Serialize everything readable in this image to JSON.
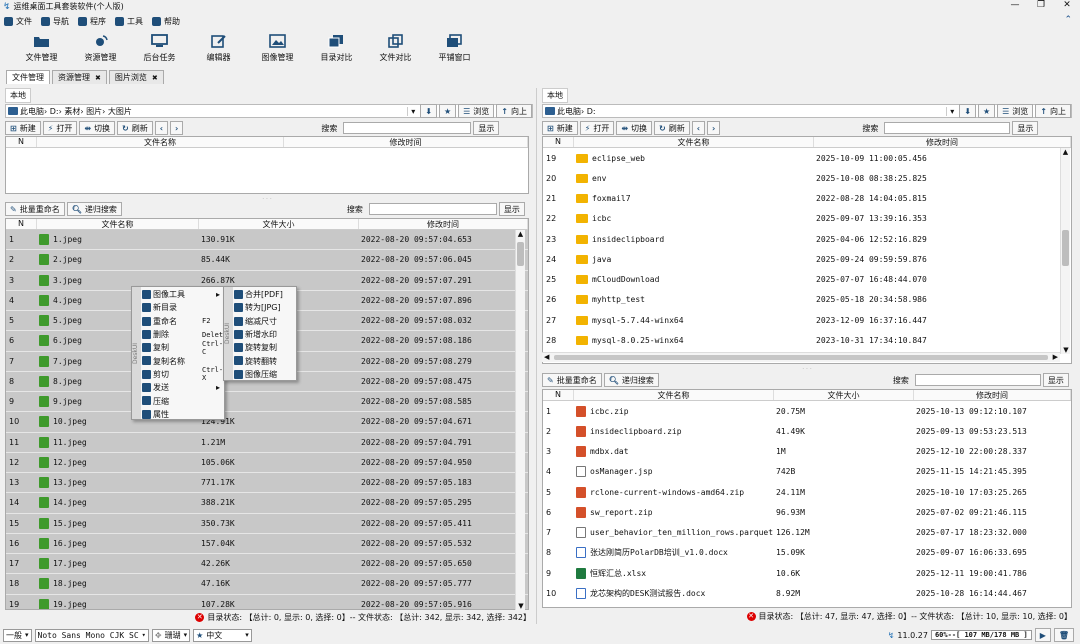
{
  "app": {
    "title": "运维桌面工具套装软件(个人版)"
  },
  "menu": [
    {
      "label": "文件",
      "icon": "file-icon"
    },
    {
      "label": "导航",
      "icon": "list-icon"
    },
    {
      "label": "程序",
      "icon": "keyboard-icon"
    },
    {
      "label": "工具",
      "icon": "toolbox-icon"
    },
    {
      "label": "帮助",
      "icon": "help-icon"
    }
  ],
  "toolbar": [
    {
      "label": "文件管理",
      "icon": "folder-open-icon"
    },
    {
      "label": "资源管理",
      "icon": "satellite-icon"
    },
    {
      "label": "后台任务",
      "icon": "monitor-icon"
    },
    {
      "label": "编辑器",
      "icon": "edit-icon"
    },
    {
      "label": "图像管理",
      "icon": "image-icon"
    },
    {
      "label": "目录对比",
      "icon": "copy-icon"
    },
    {
      "label": "文件对比",
      "icon": "file-compare-icon"
    },
    {
      "label": "平铺窗口",
      "icon": "windows-icon"
    }
  ],
  "tabs": [
    {
      "label": "文件管理",
      "closable": false
    },
    {
      "label": "资源管理",
      "closable": true,
      "close": "✖"
    },
    {
      "label": "图片浏览",
      "closable": true,
      "close": "✖"
    }
  ],
  "left": {
    "location": "本地",
    "path": "此电脑› D:› 素材› 图片› 大图片",
    "buttons": {
      "new": "新建",
      "open": "打开",
      "switch": "切换",
      "refresh": "刷新",
      "browse": "浏览",
      "up": "向上",
      "show": "显示",
      "search_label": "搜索",
      "batch_rename": "批量重命名",
      "recursive_search": "递归搜索"
    },
    "top_table_headers": [
      "N",
      "文件名称",
      "修改时间"
    ],
    "file_headers": [
      "N",
      "文件名称",
      "文件大小",
      "修改时间"
    ],
    "files": [
      {
        "n": "1",
        "name": "1.jpeg",
        "size": "130.91K",
        "time": "2022-08-20 09:57:04.653"
      },
      {
        "n": "2",
        "name": "2.jpeg",
        "size": "85.44K",
        "time": "2022-08-20 09:57:06.045"
      },
      {
        "n": "3",
        "name": "3.jpeg",
        "size": "266.87K",
        "time": "2022-08-20 09:57:07.291"
      },
      {
        "n": "4",
        "name": "4.jpeg",
        "size": "",
        "time": "2022-08-20 09:57:07.896"
      },
      {
        "n": "5",
        "name": "5.jpeg",
        "size": "",
        "time": "2022-08-20 09:57:08.032"
      },
      {
        "n": "6",
        "name": "6.jpeg",
        "size": "",
        "time": "2022-08-20 09:57:08.186"
      },
      {
        "n": "7",
        "name": "7.jpeg",
        "size": "",
        "time": "2022-08-20 09:57:08.279"
      },
      {
        "n": "8",
        "name": "8.jpeg",
        "size": "",
        "time": "2022-08-20 09:57:08.475"
      },
      {
        "n": "9",
        "name": "9.jpeg",
        "size": "",
        "time": "2022-08-20 09:57:08.585"
      },
      {
        "n": "10",
        "name": "10.jpeg",
        "size": "124.91K",
        "time": "2022-08-20 09:57:04.671"
      },
      {
        "n": "11",
        "name": "11.jpeg",
        "size": "1.21M",
        "time": "2022-08-20 09:57:04.791"
      },
      {
        "n": "12",
        "name": "12.jpeg",
        "size": "105.06K",
        "time": "2022-08-20 09:57:04.950"
      },
      {
        "n": "13",
        "name": "13.jpeg",
        "size": "771.17K",
        "time": "2022-08-20 09:57:05.183"
      },
      {
        "n": "14",
        "name": "14.jpeg",
        "size": "388.21K",
        "time": "2022-08-20 09:57:05.295"
      },
      {
        "n": "15",
        "name": "15.jpeg",
        "size": "350.73K",
        "time": "2022-08-20 09:57:05.411"
      },
      {
        "n": "16",
        "name": "16.jpeg",
        "size": "157.04K",
        "time": "2022-08-20 09:57:05.532"
      },
      {
        "n": "17",
        "name": "17.jpeg",
        "size": "42.26K",
        "time": "2022-08-20 09:57:05.650"
      },
      {
        "n": "18",
        "name": "18.jpeg",
        "size": "47.16K",
        "time": "2022-08-20 09:57:05.777"
      },
      {
        "n": "19",
        "name": "19.jpeg",
        "size": "107.28K",
        "time": "2022-08-20 09:57:05.916"
      }
    ],
    "status": "目录状态: 【总计: 0, 显示: 0, 选择: 0】-- 文件状态: 【总计: 342, 显示: 342, 选择: 342】"
  },
  "context_menu": {
    "side_label": "DeskUI",
    "items": [
      {
        "label": "图像工具",
        "shortcut": "",
        "submenu": true
      },
      {
        "label": "新目录",
        "shortcut": "",
        "submenu": false
      },
      {
        "label": "重命名",
        "shortcut": "F2",
        "submenu": false
      },
      {
        "label": "删除",
        "shortcut": "Delete",
        "submenu": false
      },
      {
        "label": "复制",
        "shortcut": "Ctrl-C",
        "submenu": false
      },
      {
        "label": "复制名称",
        "shortcut": "",
        "submenu": false
      },
      {
        "label": "剪切",
        "shortcut": "Ctrl-X",
        "submenu": false
      },
      {
        "label": "发送",
        "shortcut": "",
        "submenu": true
      },
      {
        "label": "压缩",
        "shortcut": "",
        "submenu": false
      },
      {
        "label": "属性",
        "shortcut": "",
        "submenu": false
      }
    ],
    "submenu_side_label": "DeskUI",
    "submenu": [
      "合并[PDF]",
      "转为[JPG]",
      "缩减尺寸",
      "新增水印",
      "旋转复制",
      "旋转翻转",
      "图像压缩"
    ]
  },
  "right": {
    "location": "本地",
    "path": "此电脑› D:",
    "buttons": {
      "new": "新建",
      "open": "打开",
      "switch": "切换",
      "refresh": "刷新",
      "browse": "浏览",
      "up": "向上",
      "show": "显示",
      "search_label": "搜索",
      "batch_rename": "批量重命名",
      "recursive_search": "递归搜索"
    },
    "dir_headers": [
      "N",
      "文件名称",
      "修改时间"
    ],
    "dirs": [
      {
        "n": "19",
        "name": "eclipse_web",
        "time": "2025-10-09 11:00:05.456"
      },
      {
        "n": "20",
        "name": "env",
        "time": "2025-10-08 08:38:25.825"
      },
      {
        "n": "21",
        "name": "foxmail7",
        "time": "2022-08-28 14:04:05.815"
      },
      {
        "n": "22",
        "name": "icbc",
        "time": "2025-09-07 13:39:16.353"
      },
      {
        "n": "23",
        "name": "insideclipboard",
        "time": "2025-04-06 12:52:16.829"
      },
      {
        "n": "24",
        "name": "java",
        "time": "2025-09-24 09:59:59.876"
      },
      {
        "n": "25",
        "name": "mCloudDownload",
        "time": "2025-07-07 16:48:44.070"
      },
      {
        "n": "26",
        "name": "myhttp_test",
        "time": "2025-05-18 20:34:58.986"
      },
      {
        "n": "27",
        "name": "mysql-5.7.44-winx64",
        "time": "2023-12-09 16:37:16.447"
      },
      {
        "n": "28",
        "name": "mysql-8.0.25-winx64",
        "time": "2023-10-31 17:34:10.847"
      }
    ],
    "file_headers": [
      "N",
      "文件名称",
      "文件大小",
      "修改时间"
    ],
    "files": [
      {
        "n": "1",
        "name": "icbc.zip",
        "size": "20.75M",
        "time": "2025-10-13 09:12:10.107",
        "type": "zip"
      },
      {
        "n": "2",
        "name": "insideclipboard.zip",
        "size": "41.49K",
        "time": "2025-09-13 09:53:23.513",
        "type": "zip"
      },
      {
        "n": "3",
        "name": "mdbx.dat",
        "size": "1M",
        "time": "2025-12-10 22:00:28.337",
        "type": "zip"
      },
      {
        "n": "4",
        "name": "osManager.jsp",
        "size": "742B",
        "time": "2025-11-15 14:21:45.395",
        "type": "doc"
      },
      {
        "n": "5",
        "name": "rclone-current-windows-amd64.zip",
        "size": "24.11M",
        "time": "2025-10-10 17:03:25.265",
        "type": "zip"
      },
      {
        "n": "6",
        "name": "sw_report.zip",
        "size": "96.93M",
        "time": "2025-07-02 09:21:46.115",
        "type": "zip"
      },
      {
        "n": "7",
        "name": "user_behavior_ten_million_rows.parquet",
        "size": "126.12M",
        "time": "2025-07-17 18:23:32.000",
        "type": "doc"
      },
      {
        "n": "8",
        "name": "张达刚简历PolarDB培训_v1.0.docx",
        "size": "15.09K",
        "time": "2025-09-07 16:06:33.695",
        "type": "word"
      },
      {
        "n": "9",
        "name": "恒辉汇总.xlsx",
        "size": "10.6K",
        "time": "2025-12-11 19:00:41.786",
        "type": "xls"
      },
      {
        "n": "10",
        "name": "龙芯架构的DESK测试报告.docx",
        "size": "8.92M",
        "time": "2025-10-28 16:14:44.467",
        "type": "word"
      }
    ],
    "status": "目录状态: 【总计: 47, 显示: 47, 选择: 0】-- 文件状态: 【总计: 10, 显示: 10, 选择: 0】"
  },
  "bottom": {
    "mode": "一般",
    "font": "Noto Sans Mono CJK SC",
    "theme": "珊瑚",
    "lang": "中文",
    "version": "11.0.27",
    "memory": "60%--[ 107 MB/178 MB ]"
  },
  "colors": {
    "accent": "#1f4e79",
    "selection": "#c8c8c8",
    "error": "#d00000"
  }
}
